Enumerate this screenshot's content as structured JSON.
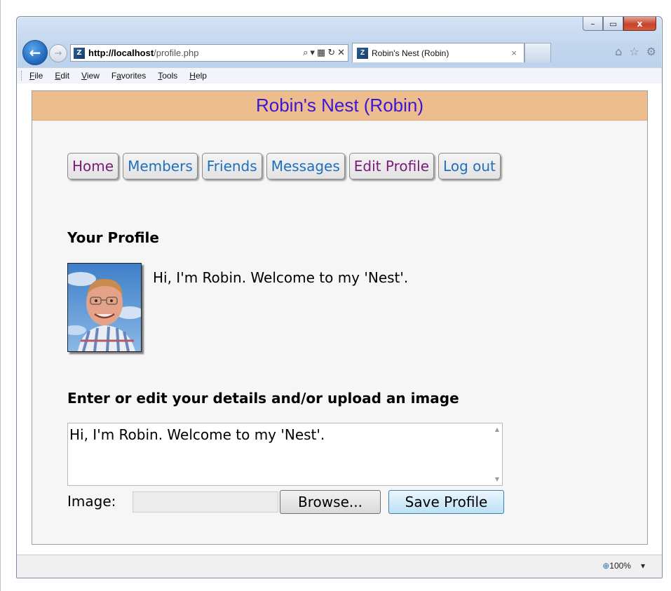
{
  "browser": {
    "url_host": "http://localhost",
    "url_path": "/profile.php",
    "tab_title": "Robin's Nest (Robin)",
    "tab_close": "×",
    "caption": {
      "minimize": "–",
      "maximize": "▭",
      "close": "x"
    },
    "menu": [
      {
        "label": "File",
        "ul": "F",
        "rest": "ile"
      },
      {
        "label": "Edit",
        "ul": "E",
        "rest": "dit"
      },
      {
        "label": "View",
        "ul": "V",
        "rest": "iew"
      },
      {
        "label": "Favorites",
        "pre": "F",
        "ul": "a",
        "rest": "vorites"
      },
      {
        "label": "Tools",
        "ul": "T",
        "rest": "ools"
      },
      {
        "label": "Help",
        "ul": "H",
        "rest": "elp"
      }
    ],
    "zoom": "100%",
    "icons": {
      "back": "back-arrow-icon",
      "forward": "forward-arrow-icon",
      "home": "home-icon",
      "favorites": "star-icon",
      "settings": "gear-icon"
    }
  },
  "site": {
    "header": "Robin's Nest (Robin)",
    "nav": [
      {
        "label": "Home",
        "visited": true
      },
      {
        "label": "Members",
        "visited": false
      },
      {
        "label": "Friends",
        "visited": false
      },
      {
        "label": "Messages",
        "visited": false
      },
      {
        "label": "Edit Profile",
        "visited": true
      },
      {
        "label": "Log out",
        "visited": false
      }
    ],
    "profile_heading": "Your Profile",
    "profile_text": "Hi, I'm Robin. Welcome to my 'Nest'.",
    "edit_heading": "Enter or edit your details and/or upload an image",
    "textarea_value": "Hi, I'm Robin. Welcome to my 'Nest'.",
    "image_label": "Image:",
    "browse_label": "Browse...",
    "save_label": "Save Profile"
  }
}
